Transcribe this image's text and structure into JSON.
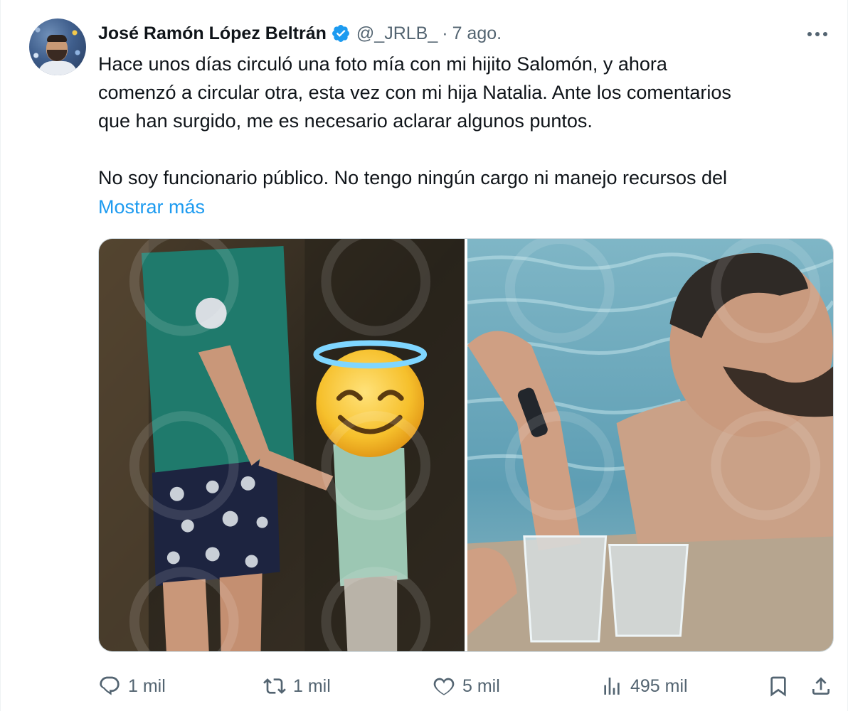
{
  "author": {
    "name": "José Ramón López Beltrán",
    "handle": "@_JRLB_",
    "separator": "·",
    "time": "7 ago."
  },
  "icons": {
    "verified": "verified-badge-icon",
    "more": "more-options-icon",
    "reply": "reply-icon",
    "retweet": "retweet-icon",
    "like": "heart-icon",
    "views": "views-chart-icon",
    "bookmark": "bookmark-icon",
    "share": "share-icon"
  },
  "tweet": {
    "line1": "Hace unos días circuló una foto mía con mi hijito Salomón, y ahora",
    "line2": "comenzó a circular otra, esta vez con mi hija Natalia. Ante los comentarios",
    "line3": "que han surgido, me es necesario aclarar algunos puntos.",
    "line4": "No soy funcionario público. No tengo ningún cargo ni manejo recursos del",
    "show_more": "Mostrar más"
  },
  "stats": {
    "replies": "1 mil",
    "retweets": "1 mil",
    "likes": "5 mil",
    "views": "495 mil"
  },
  "colors": {
    "accent": "#1d9bf0",
    "text": "#0f1419",
    "secondary": "#536471",
    "border": "#cfd9de"
  }
}
